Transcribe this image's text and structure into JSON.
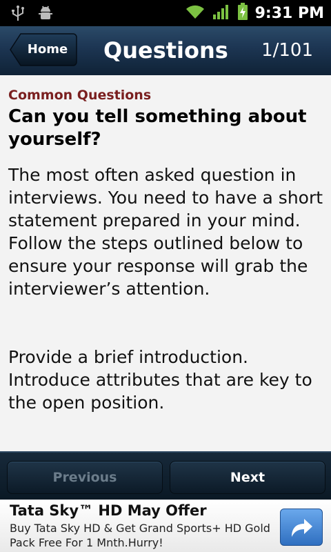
{
  "status_bar": {
    "time": "9:31 PM",
    "icons": [
      "usb-icon",
      "android-debug-icon",
      "wifi-icon",
      "signal-icon",
      "battery-charging-icon"
    ]
  },
  "header": {
    "home_label": "Home",
    "title": "Questions",
    "counter": "1/101"
  },
  "content": {
    "category": "Common Questions",
    "question": "Can you tell something about yourself?",
    "answer_paragraphs": [
      "The most often asked question in interviews. You need to have a short statement prepared in your mind.",
      "Follow the steps outlined below to ensure your response will grab the interviewer’s attention.",
      "Provide a brief introduction.",
      "Introduce attributes that are key to the open position."
    ]
  },
  "nav": {
    "previous_label": "Previous",
    "next_label": "Next"
  },
  "ad": {
    "title": "Tata Sky™ HD May Offer",
    "text": "Buy Tata Sky HD & Get Grand Sports+ HD Gold Pack Free For 1 Mnth.Hurry!",
    "action_icon": "share-arrow-icon"
  },
  "colors": {
    "header": "#1c3552",
    "category": "#7a1f1f",
    "accent_green": "#7cc142",
    "ad_button": "#3f83d4"
  }
}
